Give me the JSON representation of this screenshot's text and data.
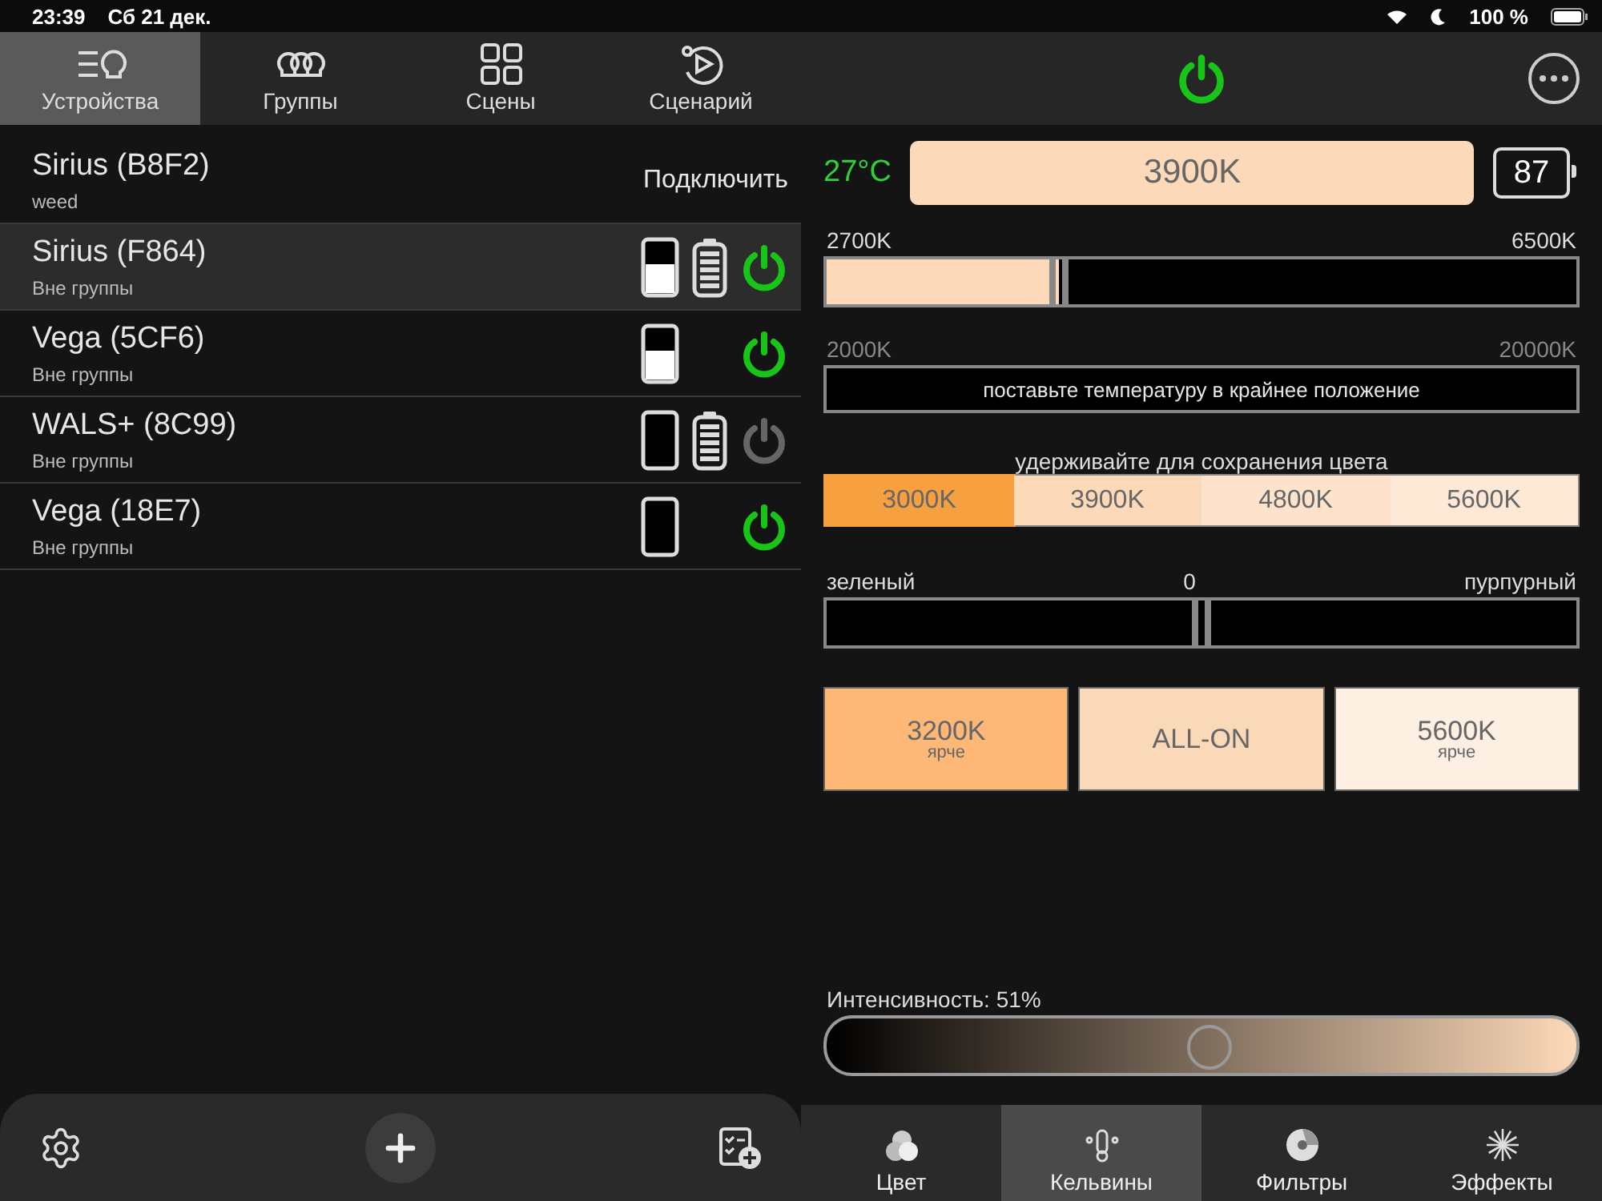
{
  "status_bar": {
    "time": "23:39",
    "date": "Сб 21 дек.",
    "battery": "100 %"
  },
  "nav_tabs": [
    {
      "label": "Устройства",
      "selected": true
    },
    {
      "label": "Группы",
      "selected": false
    },
    {
      "label": "Сцены",
      "selected": false
    },
    {
      "label": "Сценарий",
      "selected": false
    }
  ],
  "devices": [
    {
      "kind": "connect",
      "name": "Sirius (B8F2)",
      "group": "weed",
      "action": "Подключить",
      "selected": false
    },
    {
      "kind": "connected",
      "name": "Sirius (F864)",
      "group": "Вне группы",
      "filled": true,
      "battery": true,
      "on": true,
      "selected": true
    },
    {
      "kind": "connected",
      "name": "Vega (5CF6)",
      "group": "Вне группы",
      "filled": true,
      "battery": false,
      "on": true,
      "selected": false
    },
    {
      "kind": "connected",
      "name": "WALS+ (8C99)",
      "group": "Вне группы",
      "filled": false,
      "battery": true,
      "on": false,
      "selected": false
    },
    {
      "kind": "connected",
      "name": "Vega (18E7)",
      "group": "Вне группы",
      "filled": false,
      "battery": false,
      "on": true,
      "selected": false
    }
  ],
  "light": {
    "on": true,
    "temperature": "27°C",
    "kelvin": "3900K",
    "battery": "87"
  },
  "cct_slider": {
    "min_label": "2700K",
    "max_label": "6500K",
    "level": 0.31
  },
  "extended_range": {
    "min_label": "2000K",
    "max_label": "20000K",
    "button": "поставьте температуру в крайнее положение"
  },
  "presets": {
    "title": "удерживайте для сохранения цвета",
    "items": [
      {
        "label": "3000K",
        "color": "#f7a040",
        "selected": true
      },
      {
        "label": "3900K",
        "color": "#fcd9b8",
        "selected": false
      },
      {
        "label": "4800K",
        "color": "#fde3cc",
        "selected": false
      },
      {
        "label": "5600K",
        "color": "#fee9d6",
        "selected": false
      }
    ]
  },
  "tint_slider": {
    "left_label": "зеленый",
    "center_label": "0",
    "right_label": "пурпурный",
    "level": 0.5
  },
  "quick_buttons": [
    {
      "label": "3200K",
      "sublabel": "ярче",
      "color": "#fdb877"
    },
    {
      "label": "ALL-ON",
      "color": "#fad9b8"
    },
    {
      "label": "5600K",
      "sublabel": "ярче",
      "color": "#feefe3"
    }
  ],
  "intensity": {
    "label": "Интенсивность: 51%",
    "level": 0.51
  },
  "mode_tabs": [
    {
      "label": "Цвет",
      "selected": false
    },
    {
      "label": "Кельвины",
      "selected": true
    },
    {
      "label": "Фильтры",
      "selected": false
    },
    {
      "label": "Эффекты",
      "selected": false
    }
  ]
}
